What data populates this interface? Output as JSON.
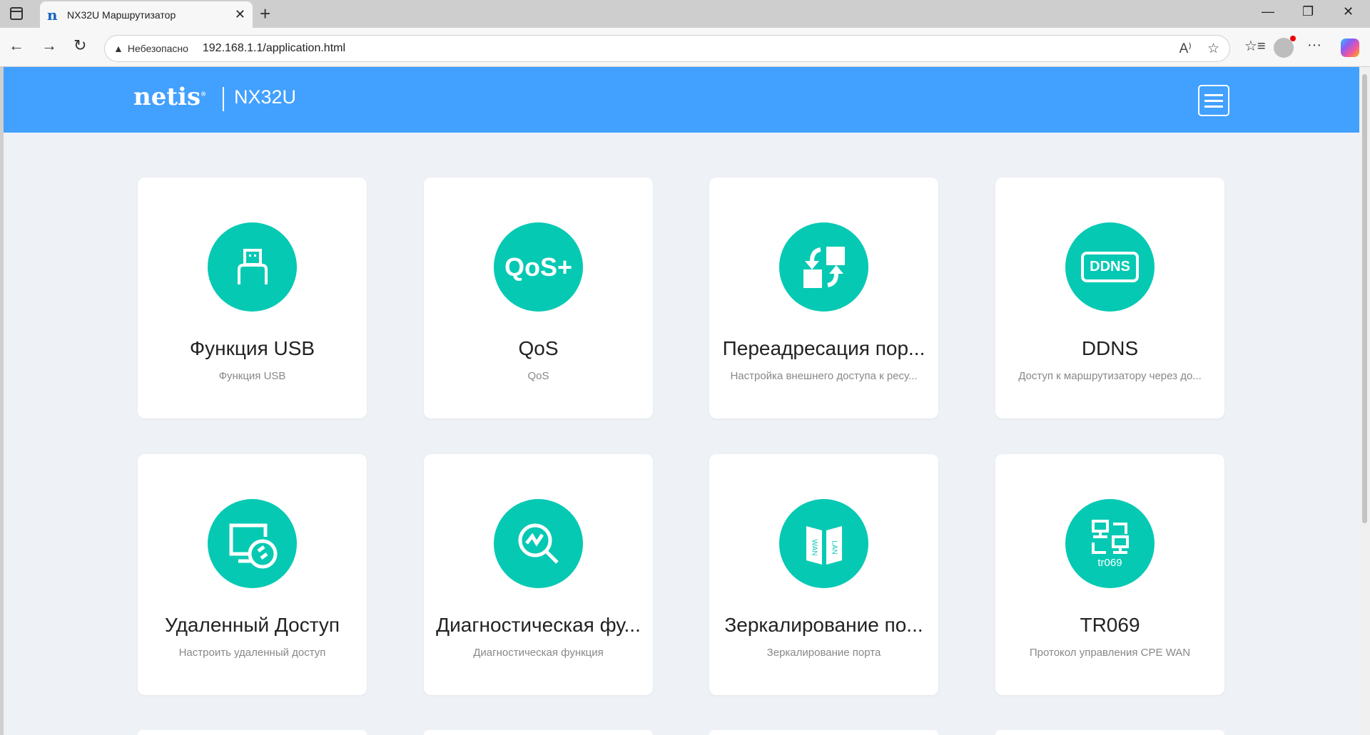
{
  "browser": {
    "tab_title": "NX32U Маршрутизатор",
    "tab_favicon": "n",
    "security_label": "Небезопасно",
    "url": "192.168.1.1/application.html"
  },
  "header": {
    "brand": "netis",
    "model": "NX32U"
  },
  "colors": {
    "header": "#42a0ff",
    "icon_bg": "#06c9b3",
    "page_bg": "#eef2f6"
  },
  "cards": [
    {
      "title": "Функция USB",
      "subtitle": "Функция USB",
      "icon": "usb-icon"
    },
    {
      "title": "QoS",
      "subtitle": "QoS",
      "icon": "qos-icon",
      "icon_text": "QoS+"
    },
    {
      "title": "Переадресация пор...",
      "subtitle": "Настройка внешнего доступа к ресу...",
      "icon": "port-forwarding-icon"
    },
    {
      "title": "DDNS",
      "subtitle": "Доступ к маршрутизатору через до...",
      "icon": "ddns-icon",
      "icon_text": "DDNS"
    },
    {
      "title": "Удаленный Доступ",
      "subtitle": "Настроить удаленный доступ",
      "icon": "remote-access-icon"
    },
    {
      "title": "Диагностическая фу...",
      "subtitle": "Диагностическая функция",
      "icon": "diagnostics-icon"
    },
    {
      "title": "Зеркалирование по...",
      "subtitle": "Зеркалирование порта",
      "icon": "port-mirroring-icon",
      "icon_text_left": "WAN",
      "icon_text_right": "LAN"
    },
    {
      "title": "TR069",
      "subtitle": "Протокол управления CPE WAN",
      "icon": "tr069-icon",
      "icon_text": "tr069"
    }
  ]
}
